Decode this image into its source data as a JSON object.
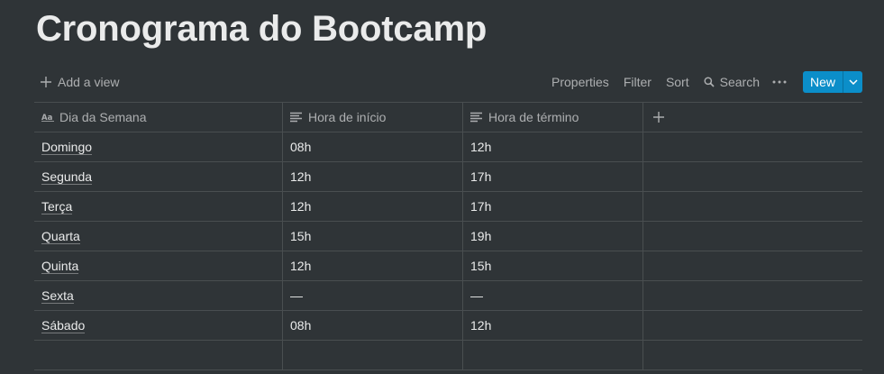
{
  "page": {
    "title": "Cronograma do Bootcamp"
  },
  "toolbar": {
    "add_view": "Add a view",
    "properties": "Properties",
    "filter": "Filter",
    "sort": "Sort",
    "search": "Search",
    "new": "New"
  },
  "table": {
    "columns": [
      "Dia da Semana",
      "Hora de início",
      "Hora de término"
    ],
    "rows": [
      [
        "Domingo",
        "08h",
        "12h"
      ],
      [
        "Segunda",
        "12h",
        "17h"
      ],
      [
        "Terça",
        "12h",
        "17h"
      ],
      [
        "Quarta",
        "15h",
        "19h"
      ],
      [
        "Quinta",
        "12h",
        "15h"
      ],
      [
        "Sexta",
        "—",
        "—"
      ],
      [
        "Sábado",
        "08h",
        "12h"
      ]
    ]
  },
  "icons": {
    "add_view": "plus-icon",
    "search": "search-icon",
    "more": "more-horizontal-icon",
    "new_dropdown": "chevron-down-icon",
    "title_property": "title-property-icon",
    "text_property": "text-property-icon",
    "add_column": "plus-icon"
  },
  "colors": {
    "background": "#2f3437",
    "accent": "#0b8ec9"
  }
}
